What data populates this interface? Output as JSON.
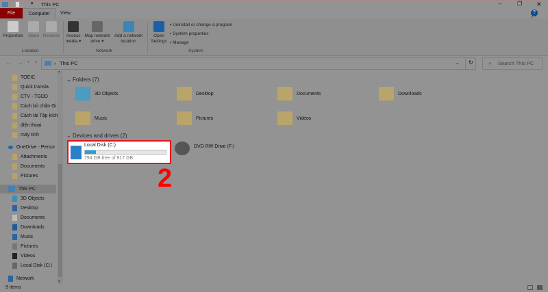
{
  "window": {
    "title": "This PC",
    "controls": [
      "minimize",
      "restore",
      "close"
    ]
  },
  "tabs": [
    "File",
    "Computer",
    "View"
  ],
  "ribbon": {
    "location": {
      "label": "Location",
      "buttons": [
        "Properties",
        "Open",
        "Rename"
      ]
    },
    "network": {
      "label": "Network",
      "buttons": [
        "Access media",
        "Map network drive",
        "Add a network location"
      ]
    },
    "system": {
      "label": "System",
      "open_settings": "Open Settings",
      "links": [
        "Uninstall or change a program",
        "System properties",
        "Manage"
      ]
    }
  },
  "address": {
    "path": "This PC",
    "search_placeholder": "Search This PC"
  },
  "sidebar": {
    "quick": [
      "TOEIC",
      "Quick transla",
      "CTV - TGDD",
      "Cách bỏ chặn Gi",
      "Cách tải Tập kích",
      "điện thoại",
      "máy tính"
    ],
    "onedrive": "OneDrive - Persor",
    "onedrive_items": [
      "Attachments",
      "Documents",
      "Pictures"
    ],
    "thispc": "This PC",
    "thispc_items": [
      "3D Objects",
      "Desktop",
      "Documents",
      "Downloads",
      "Music",
      "Pictures",
      "Videos",
      "Local Disk (C:)"
    ],
    "network": "Network"
  },
  "folders": {
    "header": "Folders (7)",
    "items": [
      "3D Objects",
      "Desktop",
      "Documents",
      "Downloads",
      "Music",
      "Pictures",
      "Videos"
    ]
  },
  "drives": {
    "header": "Devices and drives (2)",
    "local": {
      "name": "Local Disk (C:)",
      "free": "794 GB free of 917 GB",
      "used_fraction": 0.134
    },
    "dvd": {
      "name": "DVD RW Drive (F:)"
    }
  },
  "annotation": "2",
  "status": "9 items"
}
